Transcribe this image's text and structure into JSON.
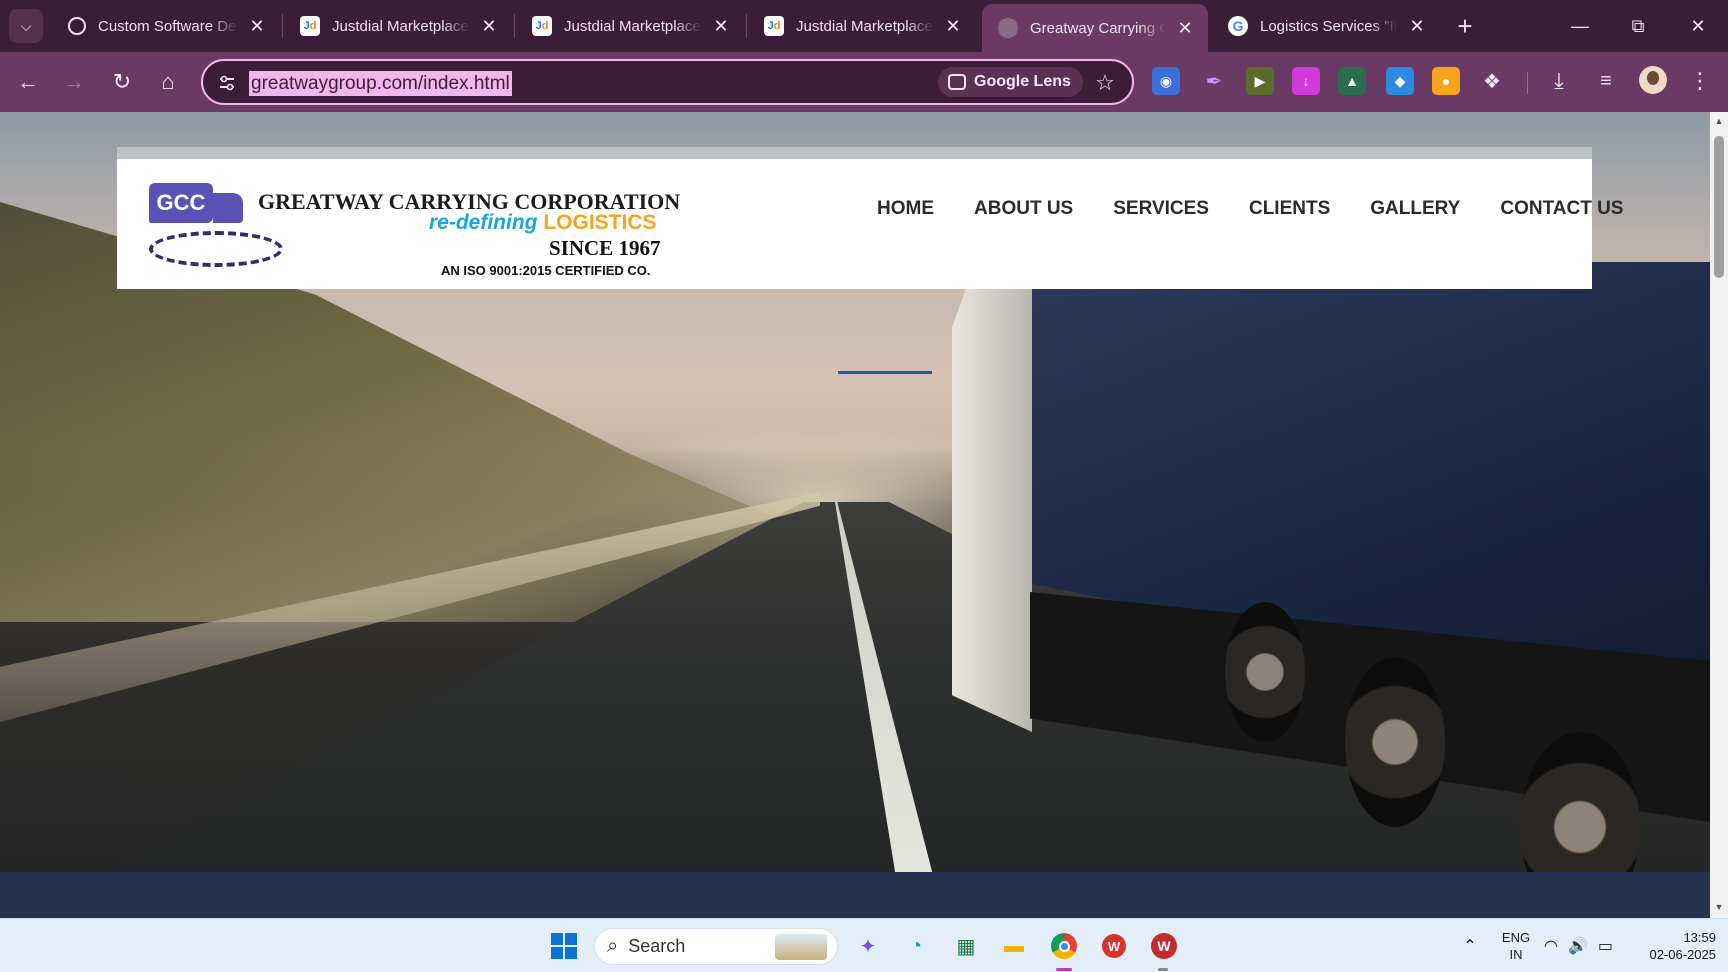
{
  "browser": {
    "tabs": [
      {
        "title": "Custom Software Deta",
        "favicon": "openai-icon",
        "active": false
      },
      {
        "title": "Justdial Marketplace -",
        "favicon": "justdial-icon",
        "active": false
      },
      {
        "title": "Justdial Marketplace -",
        "favicon": "justdial-icon",
        "active": false
      },
      {
        "title": "Justdial Marketplace -",
        "favicon": "justdial-icon",
        "active": false
      },
      {
        "title": "Greatway Carrying Cor",
        "favicon": "globe-icon",
        "active": true
      },
      {
        "title": "Logistics Services \"Ima",
        "favicon": "google-icon",
        "active": false
      }
    ],
    "new_tab_symbol": "+",
    "url": "greatwaygroup.com/index.html",
    "lens_label": "Google Lens",
    "colors": {
      "frame": "#3a1d37",
      "toolbar": "#6a3a64",
      "url_highlight": "#f3b6ea"
    }
  },
  "site": {
    "logo": {
      "badge": "GCC",
      "name": "GREATWAY CARRYING CORPORATION",
      "tagline_a": "re-defining",
      "tagline_b": "LOGISTICS",
      "since": "SINCE 1967",
      "iso": "AN ISO 9001:2015 CERTIFIED CO."
    },
    "nav": [
      "HOME",
      "ABOUT US",
      "SERVICES",
      "CLIENTS",
      "GALLERY",
      "CONTACT US"
    ],
    "active_nav": "HOME",
    "colors": {
      "accent_underline": "#1f5fa8",
      "logo_purple": "#5b52b5",
      "tagline_blue": "#1aa4e0",
      "tagline_orange": "#f7a41d"
    }
  },
  "taskbar": {
    "search_label": "Search",
    "lang_line1": "ENG",
    "lang_line2": "IN",
    "time": "13:59",
    "date": "02-06-2025"
  }
}
